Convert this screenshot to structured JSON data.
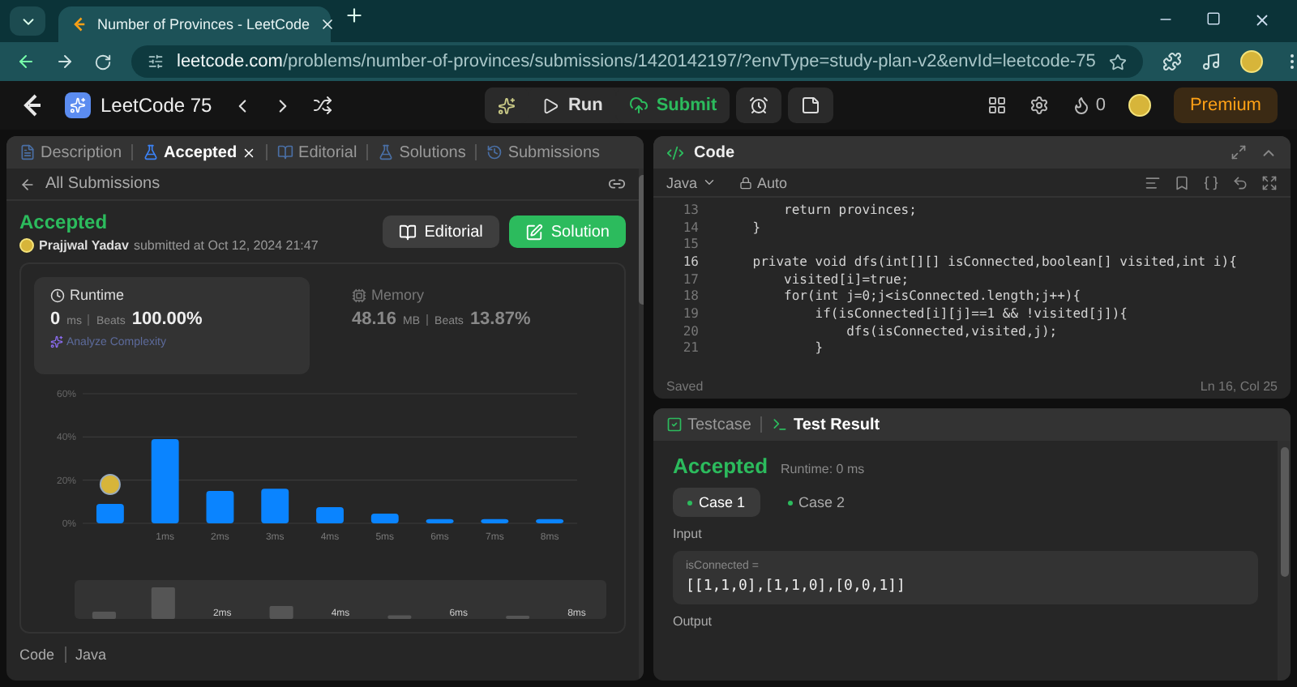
{
  "browser": {
    "tab_title": "Number of Provinces - LeetCode",
    "url_host": "leetcode.com",
    "url_path": "/problems/number-of-provinces/submissions/1420142197/?envType=study-plan-v2&envId=leetcode-75"
  },
  "topbar": {
    "study_plan": "LeetCode 75",
    "run": "Run",
    "submit": "Submit",
    "streak": "0",
    "premium": "Premium"
  },
  "left_tabs": [
    {
      "label": "Description",
      "selected": false,
      "closable": false
    },
    {
      "label": "Accepted",
      "selected": true,
      "closable": true
    },
    {
      "label": "Editorial",
      "selected": false,
      "closable": false
    },
    {
      "label": "Solutions",
      "selected": false,
      "closable": false
    },
    {
      "label": "Submissions",
      "selected": false,
      "closable": false
    }
  ],
  "back_link": "All Submissions",
  "submission": {
    "status": "Accepted",
    "author": "Prajjwal Yadav",
    "submitted": "submitted at Oct 12, 2024 21:47",
    "editorial_button": "Editorial",
    "solution_button": "Solution"
  },
  "runtime": {
    "title": "Runtime",
    "value": "0",
    "unit": "ms",
    "beats_label": "Beats",
    "beats": "100.00%",
    "analyze": "Analyze Complexity"
  },
  "memory": {
    "title": "Memory",
    "value": "48.16",
    "unit": "MB",
    "beats_label": "Beats",
    "beats": "13.87%"
  },
  "chart_data": {
    "type": "bar",
    "categories": [
      null,
      "1ms",
      "2ms",
      "3ms",
      "4ms",
      "5ms",
      "6ms",
      "7ms",
      "8ms"
    ],
    "values": [
      9,
      39,
      15,
      16,
      7.5,
      4.5,
      2,
      2,
      2
    ],
    "ylim": [
      0,
      60
    ],
    "yticks": [
      {
        "value": 0,
        "label": "0%"
      },
      {
        "value": 20,
        "label": "20%"
      },
      {
        "value": 40,
        "label": "40%"
      },
      {
        "value": 60,
        "label": "60%"
      }
    ]
  },
  "navigator": {
    "labels": [
      "2ms",
      "4ms",
      "6ms",
      "8ms"
    ]
  },
  "code_section": {
    "title": "Code",
    "language": "Java"
  },
  "editor": {
    "title": "Code",
    "language": "Java",
    "mode": "Auto",
    "status": "Saved",
    "cursor": "Ln 16, Col 25",
    "lines": [
      {
        "number": "13",
        "code": "        return provinces;",
        "current": false
      },
      {
        "number": "14",
        "code": "    }",
        "current": false
      },
      {
        "number": "15",
        "current": false
      },
      {
        "number": "16",
        "code": "    private void dfs(int[][] isConnected,boolean[] visited,int i){",
        "current": true
      },
      {
        "number": "17",
        "code": "        visited[i]=true;",
        "current": false
      },
      {
        "number": "18",
        "code": "        for(int j=0;j<isConnected.length;j++){",
        "current": false
      },
      {
        "number": "19",
        "code": "            if(isConnected[i][j]==1 && !visited[j]){",
        "current": false
      },
      {
        "number": "20",
        "code": "                dfs(isConnected,visited,j);",
        "current": false
      },
      {
        "number": "21",
        "code": "            }",
        "current": false
      }
    ]
  },
  "result_tabs": [
    {
      "label": "Testcase",
      "selected": false
    },
    {
      "label": "Test Result",
      "selected": true
    }
  ],
  "result": {
    "status": "Accepted",
    "runtime": "Runtime: 0 ms",
    "cases": [
      {
        "label": "Case 1",
        "selected": true
      },
      {
        "label": "Case 2",
        "selected": false
      }
    ],
    "input_label": "Input",
    "param": "isConnected =",
    "param_value": "[[1,1,0],[1,1,0],[0,0,1]]",
    "output_label": "Output"
  }
}
